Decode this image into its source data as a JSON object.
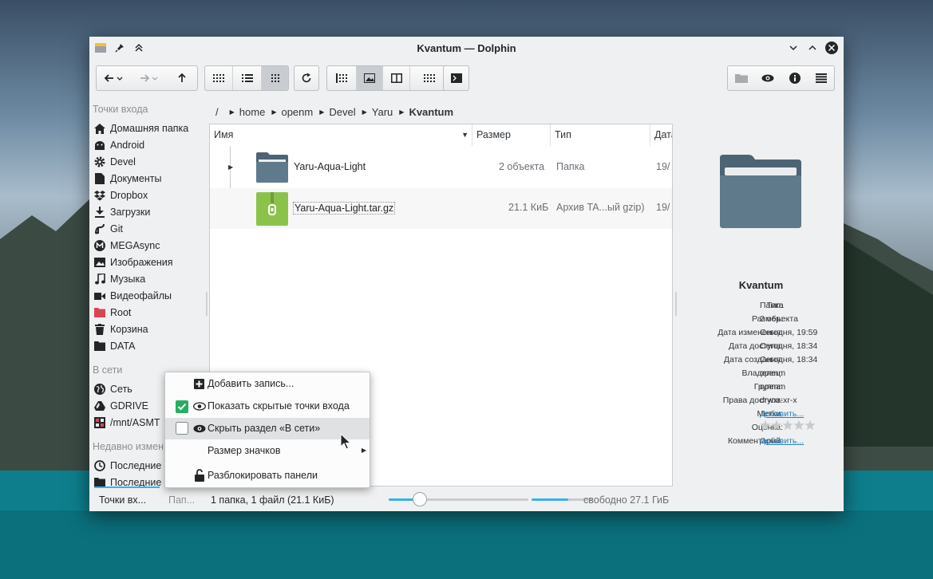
{
  "window": {
    "title": "Kvantum — Dolphin"
  },
  "breadcrumb": {
    "root": "/",
    "items": [
      "home",
      "openm",
      "Devel",
      "Yaru"
    ],
    "current": "Kvantum"
  },
  "sidebar": {
    "places_header": "Точки входа",
    "places": [
      {
        "label": "Домашняя папка",
        "icon": "home-icon"
      },
      {
        "label": "Android",
        "icon": "android-icon"
      },
      {
        "label": "Devel",
        "icon": "gear-icon"
      },
      {
        "label": "Документы",
        "icon": "document-icon"
      },
      {
        "label": "Dropbox",
        "icon": "dropbox-icon"
      },
      {
        "label": "Загрузки",
        "icon": "download-icon"
      },
      {
        "label": "Git",
        "icon": "git-icon"
      },
      {
        "label": "MEGAsync",
        "icon": "mega-icon"
      },
      {
        "label": "Изображения",
        "icon": "image-icon"
      },
      {
        "label": "Музыка",
        "icon": "music-icon"
      },
      {
        "label": "Видеофайлы",
        "icon": "video-icon"
      },
      {
        "label": "Root",
        "icon": "red-folder-icon"
      },
      {
        "label": "Корзина",
        "icon": "trash-icon"
      },
      {
        "label": "DATA",
        "icon": "folder-icon"
      }
    ],
    "network_header": "В сети",
    "network": [
      {
        "label": "Сеть",
        "icon": "globe-icon"
      },
      {
        "label": "GDRIVE",
        "icon": "gdrive-icon"
      },
      {
        "label": "/mnt/ASMT",
        "icon": "mount-icon"
      }
    ],
    "recent_header": "Недавно измен",
    "recent": [
      {
        "label": "Последние",
        "icon": "clock-icon"
      },
      {
        "label": "Последние",
        "icon": "folder-icon"
      }
    ]
  },
  "columns": {
    "name": "Имя",
    "size": "Размер",
    "type": "Тип",
    "date": "Дата"
  },
  "files": [
    {
      "name": "Yaru-Aqua-Light",
      "size": "2 объекта",
      "type": "Папка",
      "date": "19/"
    },
    {
      "name": "Yaru-Aqua-Light.tar.gz",
      "size": "21.1 КиБ",
      "type": "Архив TA...ый gzip)",
      "date": "19/"
    }
  ],
  "info_panel": {
    "name": "Kvantum",
    "rows": [
      {
        "key": "Тип:",
        "value": "Папка"
      },
      {
        "key": "Размер:",
        "value": "2 объекта"
      },
      {
        "key": "Дата изменения:",
        "value": "Сегодня, 19:59"
      },
      {
        "key": "Дата доступа:",
        "value": "Сегодня, 18:34"
      },
      {
        "key": "Дата создания:",
        "value": "Сегодня, 18:34"
      },
      {
        "key": "Владелец:",
        "value": "openm"
      },
      {
        "key": "Группа:",
        "value": "openm"
      },
      {
        "key": "Права доступа:",
        "value": "drwxr-xr-x"
      }
    ],
    "tags_key": "Метки:",
    "tags_link": "Добавить...",
    "rating_key": "Оценка:",
    "rating": 0,
    "comment_key": "Комментарий:",
    "comment_link": "Добавить..."
  },
  "context_menu": {
    "items": [
      {
        "label": "Добавить запись...",
        "icon": "add-icon"
      },
      {
        "label": "Показать скрытые точки входа",
        "icon": "eye-icon",
        "checked": true
      },
      {
        "label": "Скрыть раздел «В сети»",
        "icon": "eye-icon",
        "checked": false
      },
      {
        "label": "Размер значков",
        "submenu": true
      },
      {
        "label": "Разблокировать панели",
        "icon": "lock-icon"
      }
    ]
  },
  "statusbar": {
    "places_tab": "Точки вх...",
    "folders_tab": "Пап...",
    "summary": "1 папка, 1 файл (21.1 КиБ)",
    "zoom": 0.22,
    "free_space": "свободно 27.1 ГиБ",
    "disk_used": 0.6
  },
  "colors": {
    "accent": "#3daee9",
    "folder": "#5f7a8a",
    "archive": "#8bc34a",
    "red_folder": "#da4453",
    "check": "#27ae60"
  }
}
